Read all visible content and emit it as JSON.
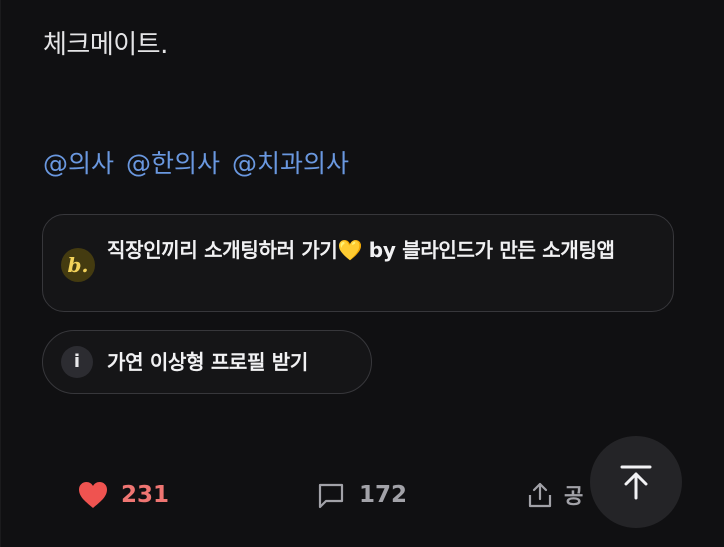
{
  "post": {
    "text": "체크메이트."
  },
  "tags": [
    "@의사",
    "@한의사",
    "@치과의사"
  ],
  "ad_card": {
    "logo_letter": "b.",
    "text_before_heart": "직장인끼리 소개팅하러 가기",
    "heart_emoji": "💛",
    "text_after_heart": " by 블라인드가 만든 소개팅앱"
  },
  "info_card": {
    "icon_glyph": "i",
    "text": "가연 이상형 프로필 받기"
  },
  "actions": {
    "like_count": "231",
    "comment_count": "172",
    "share_label": "공"
  },
  "icons": {
    "like": "heart-icon",
    "comment": "comment-icon",
    "share": "share-icon",
    "scroll_top": "arrow-up-to-top-icon"
  },
  "colors": {
    "background": "#101012",
    "tag": "#6a98e0",
    "like": "#ef7572",
    "muted": "#a2a2a8",
    "card_border": "#37373b"
  }
}
